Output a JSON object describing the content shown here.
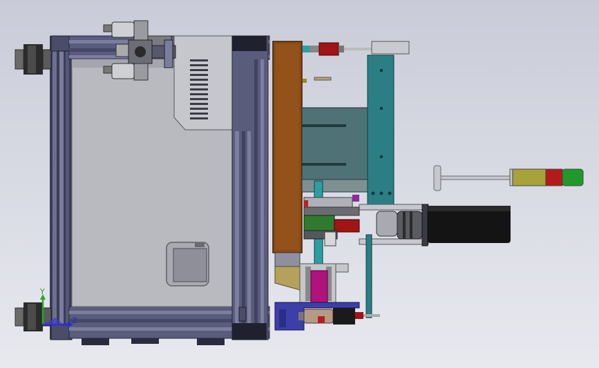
{
  "view": {
    "background_top": "#c9ccd8",
    "background_bottom": "#e8e9ef"
  },
  "colors": {
    "frame": "#5d5f7a",
    "frame_dark": "#2f3045",
    "panel": "#b7b8bf",
    "wood": "#8a4b14",
    "teal": "#2b7f84",
    "teal_dark": "#1f5f64",
    "motor": "#141414",
    "magenta": "#b0127e",
    "blue_plate": "#3d3fa8",
    "axis_y": "#22aa22",
    "axis_z": "#2a2ad0"
  },
  "axes": {
    "y_label": "Y",
    "z_label": "Z"
  },
  "signal_tower": {
    "segments": [
      "#c9c9c9",
      "#a7a23a",
      "#b51a1a",
      "#1f9a2a"
    ]
  }
}
